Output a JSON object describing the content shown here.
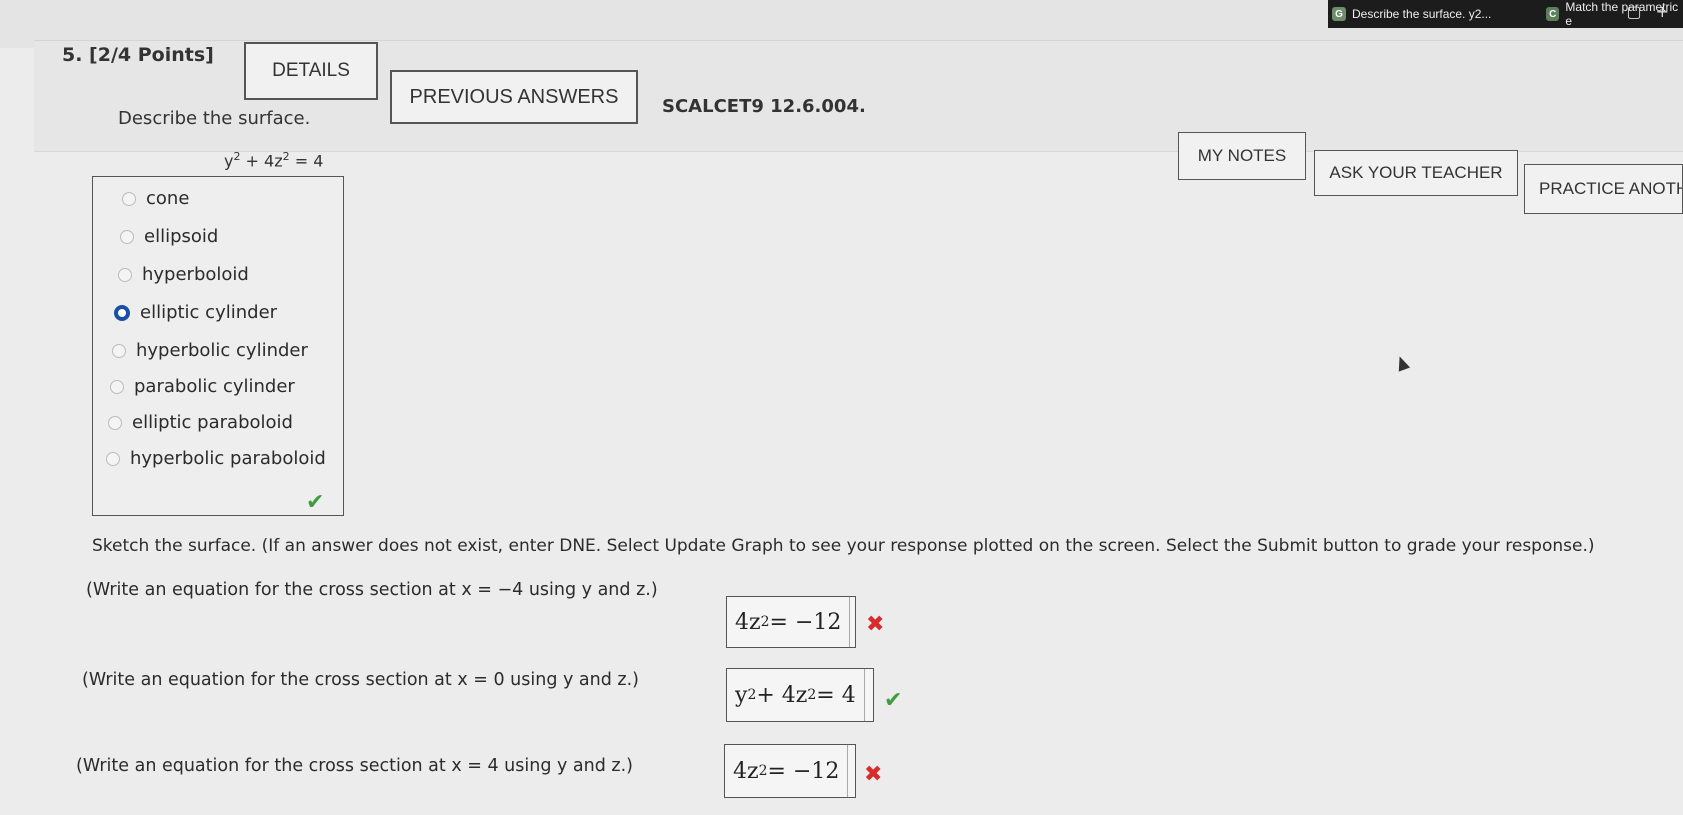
{
  "browser_tabs": [
    {
      "icon": "G",
      "label": "Describe the surface. y2..."
    },
    {
      "icon": "C",
      "label": "Match the parametric e"
    }
  ],
  "question": {
    "number_points": "5.  [2/4 Points]",
    "details_label": "DETAILS",
    "previous_answers_label": "PREVIOUS ANSWERS",
    "problem_id": "SCALCET9 12.6.004.",
    "my_notes_label": "MY NOTES",
    "ask_teacher_label": "ASK YOUR TEACHER",
    "practice_label": "PRACTICE ANOTHE"
  },
  "part1": {
    "prompt": "Describe the surface.",
    "equation": {
      "a": "y",
      "a_exp": "2",
      "mid": " + 4z",
      "b_exp": "2",
      "rhs": " = 4"
    },
    "options": [
      {
        "label": "cone",
        "selected": false
      },
      {
        "label": "ellipsoid",
        "selected": false
      },
      {
        "label": "hyperboloid",
        "selected": false
      },
      {
        "label": "elliptic cylinder",
        "selected": true
      },
      {
        "label": "hyperbolic cylinder",
        "selected": false
      },
      {
        "label": "parabolic cylinder",
        "selected": false
      },
      {
        "label": "elliptic paraboloid",
        "selected": false
      },
      {
        "label": "hyperbolic paraboloid",
        "selected": false
      }
    ],
    "result": "correct"
  },
  "part2": {
    "instruction": "Sketch the surface. (If an answer does not exist, enter DNE. Select Update Graph to see your response plotted on the screen. Select the Submit button to grade your response.)",
    "rows": [
      {
        "label": "(Write an equation for the cross section at x = −4 using y and z.)",
        "answer_pre": "4z",
        "answer_exp": "2",
        "answer_post": " = −12",
        "result": "incorrect"
      },
      {
        "label": "(Write an equation for the cross section at x = 0 using y and z.)",
        "answer_pre": "y",
        "answer_exp": "2",
        "answer_post": " + 4z",
        "answer_exp2": "2",
        "answer_post2": " = 4",
        "result": "correct"
      },
      {
        "label": "(Write an equation for the cross section at x = 4 using y and z.)",
        "answer_pre": "4z",
        "answer_exp": "2",
        "answer_post": " = −12",
        "result": "incorrect"
      }
    ]
  },
  "colors": {
    "correct": "#3f9c3f",
    "incorrect": "#d82b2b",
    "selected_radio": "#1a4fa8"
  }
}
